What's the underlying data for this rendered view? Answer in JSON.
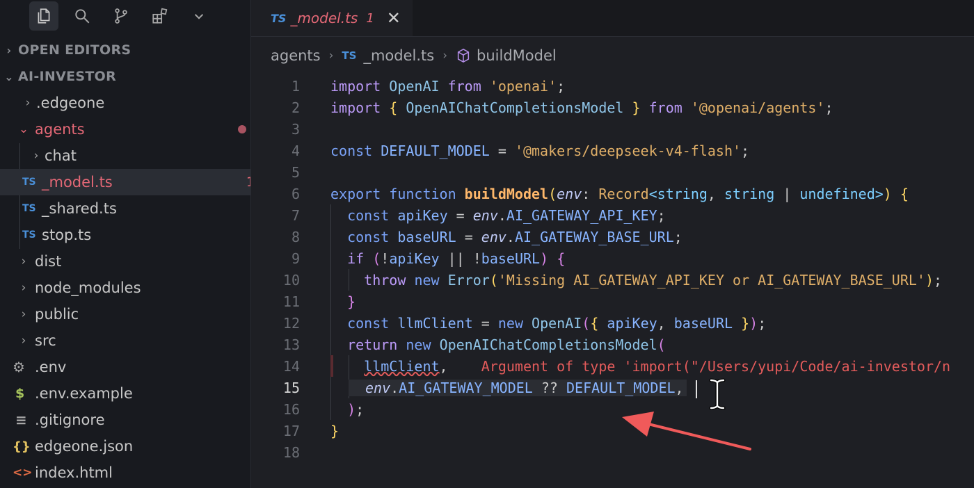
{
  "activity_bar": {
    "icons": [
      "explorer-icon",
      "search-icon",
      "source-control-icon",
      "extensions-icon",
      "chevron-down-icon"
    ]
  },
  "sidebar": {
    "sections": {
      "open_editors": "OPEN EDITORS",
      "project": "AI-INVESTOR"
    },
    "items": [
      {
        "label": ".edgeone",
        "type": "folder",
        "chev": "›"
      },
      {
        "label": "agents",
        "type": "folder-open",
        "chev": "⌄"
      },
      {
        "label": "chat",
        "type": "folder",
        "chev": "›"
      },
      {
        "label": "_model.ts",
        "type": "ts",
        "icon_text": "TS",
        "badge": "1"
      },
      {
        "label": "_shared.ts",
        "type": "ts",
        "icon_text": "TS"
      },
      {
        "label": "stop.ts",
        "type": "ts",
        "icon_text": "TS"
      },
      {
        "label": "dist",
        "type": "folder",
        "chev": "›"
      },
      {
        "label": "node_modules",
        "type": "folder",
        "chev": "›"
      },
      {
        "label": "public",
        "type": "folder",
        "chev": "›"
      },
      {
        "label": "src",
        "type": "folder",
        "chev": "›"
      },
      {
        "label": ".env",
        "type": "gear",
        "icon_text": "⚙"
      },
      {
        "label": ".env.example",
        "type": "dollar",
        "icon_text": "$"
      },
      {
        "label": ".gitignore",
        "type": "lines",
        "icon_text": "≡"
      },
      {
        "label": "edgeone.json",
        "type": "json",
        "icon_text": "{}"
      },
      {
        "label": "index.html",
        "type": "html",
        "icon_text": "<>"
      }
    ]
  },
  "tab": {
    "lang": "TS",
    "name": "_model.ts",
    "problem_count": "1",
    "close": "✕"
  },
  "breadcrumb": {
    "folder": "agents",
    "lang": "TS",
    "file": "_model.ts",
    "symbol": "buildModel"
  },
  "editor": {
    "line_numbers": [
      "1",
      "2",
      "3",
      "4",
      "5",
      "6",
      "7",
      "8",
      "9",
      "10",
      "11",
      "12",
      "13",
      "14",
      "15",
      "16",
      "17",
      "18"
    ],
    "current_line": "15",
    "inline_error": "Argument of type 'import(\"/Users/yupi/Code/ai-investor/n"
  },
  "colors": {
    "error": "#e35b5b",
    "modified": "#e46876",
    "ts_icon": "#4a90d9",
    "annotation_arrow": "#f05a5a"
  }
}
